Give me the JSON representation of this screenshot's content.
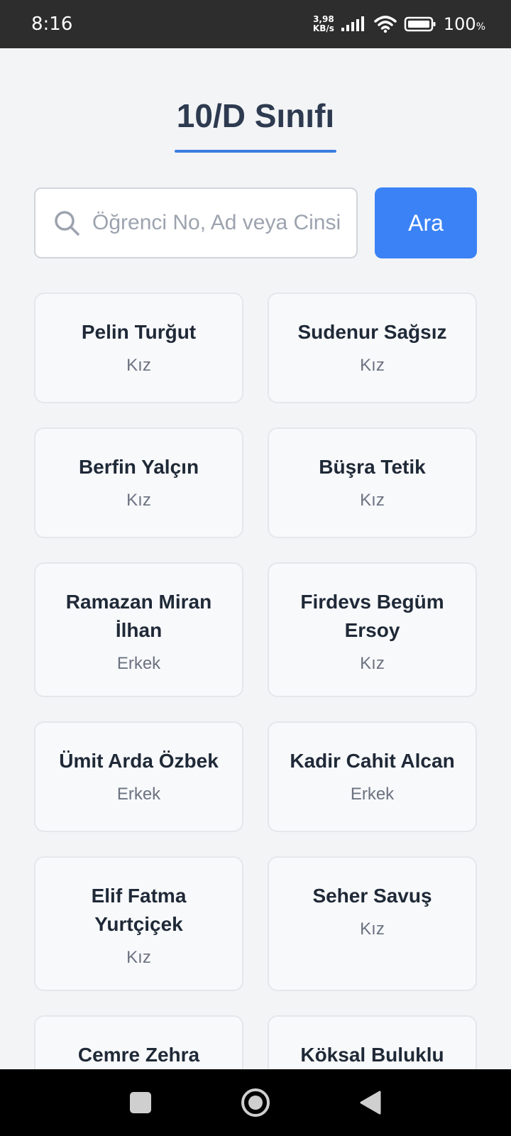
{
  "status_bar": {
    "time": "8:16",
    "net_speed_value": "3,98",
    "net_speed_unit": "KB/s",
    "battery": "100",
    "battery_unit": "%"
  },
  "page": {
    "title": "10/D Sınıfı"
  },
  "search": {
    "placeholder": "Öğrenci No, Ad veya Cinsiyet",
    "value": "",
    "button_label": "Ara"
  },
  "students": [
    {
      "name": "Pelin Turğut",
      "gender": "Kız"
    },
    {
      "name": "Sudenur Sağsız",
      "gender": "Kız"
    },
    {
      "name": "Berfin Yalçın",
      "gender": "Kız"
    },
    {
      "name": "Büşra Tetik",
      "gender": "Kız"
    },
    {
      "name": "Ramazan Miran İlhan",
      "gender": "Erkek"
    },
    {
      "name": "Firdevs Begüm Ersoy",
      "gender": "Kız"
    },
    {
      "name": "Ümit Arda Özbek",
      "gender": "Erkek"
    },
    {
      "name": "Kadir Cahit Alcan",
      "gender": "Erkek"
    },
    {
      "name": "Elif Fatma Yurtçiçek",
      "gender": "Kız"
    },
    {
      "name": "Seher Savuş",
      "gender": "Kız"
    },
    {
      "name": "Cemre Zehra",
      "gender": ""
    },
    {
      "name": "Köksal Buluklu",
      "gender": ""
    }
  ],
  "nav": {
    "recents_icon": "square-icon",
    "home_icon": "circle-icon",
    "back_icon": "triangle-back-icon"
  },
  "colors": {
    "accent": "#3b82f6",
    "title": "#2d3a4f",
    "underline": "#3b7de0"
  }
}
